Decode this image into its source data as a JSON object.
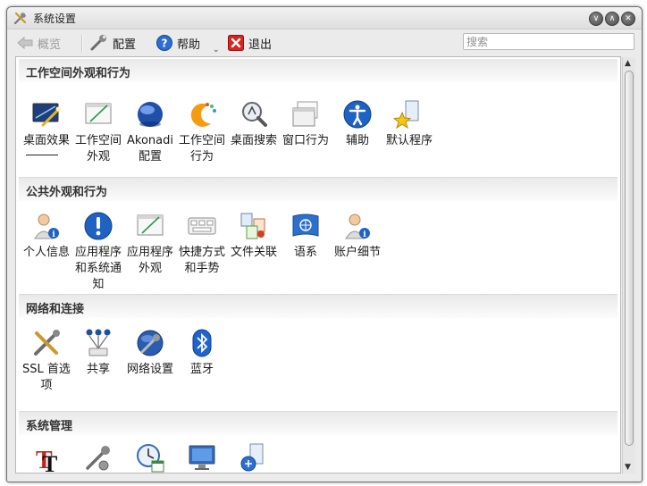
{
  "window": {
    "title": "系统设置"
  },
  "toolbar": {
    "overview_label": "概览",
    "configure_label": "配置",
    "help_label": "帮助",
    "quit_label": "退出",
    "search_placeholder": "搜索"
  },
  "sections": [
    {
      "title": "工作空间外观和行为",
      "items": [
        {
          "label": "桌面效果",
          "icon": "desktop-effects-icon"
        },
        {
          "label": "工作空间外观",
          "icon": "workspace-appearance-icon"
        },
        {
          "label": "Akonadi 配置",
          "icon": "akonadi-icon"
        },
        {
          "label": "工作空间行为",
          "icon": "workspace-behavior-icon"
        },
        {
          "label": "桌面搜索",
          "icon": "desktop-search-icon"
        },
        {
          "label": "窗口行为",
          "icon": "window-behavior-icon"
        },
        {
          "label": "辅助",
          "icon": "accessibility-icon"
        },
        {
          "label": "默认程序",
          "icon": "default-applications-icon"
        }
      ]
    },
    {
      "title": "公共外观和行为",
      "items": [
        {
          "label": "个人信息",
          "icon": "personal-info-icon"
        },
        {
          "label": "应用程序和系统通知",
          "icon": "notifications-icon"
        },
        {
          "label": "应用程序外观",
          "icon": "application-appearance-icon"
        },
        {
          "label": "快捷方式和手势",
          "icon": "shortcuts-icon"
        },
        {
          "label": "文件关联",
          "icon": "file-associations-icon"
        },
        {
          "label": "语系",
          "icon": "locale-icon"
        },
        {
          "label": "账户细节",
          "icon": "account-details-icon"
        }
      ]
    },
    {
      "title": "网络和连接",
      "items": [
        {
          "label": "SSL 首选项",
          "icon": "ssl-icon"
        },
        {
          "label": "共享",
          "icon": "sharing-icon"
        },
        {
          "label": "网络设置",
          "icon": "network-settings-icon"
        },
        {
          "label": "蓝牙",
          "icon": "bluetooth-icon"
        }
      ]
    },
    {
      "title": "系统管理",
      "items": [
        {
          "label": "",
          "icon": "font-installer-icon"
        },
        {
          "label": "",
          "icon": "system-tools-icon"
        },
        {
          "label": "",
          "icon": "date-time-icon"
        },
        {
          "label": "",
          "icon": "display-icon"
        },
        {
          "label": "",
          "icon": "software-icon"
        }
      ]
    }
  ],
  "colors": {
    "accent": "#2a6fc9",
    "section_header": "#e9e9e9"
  }
}
